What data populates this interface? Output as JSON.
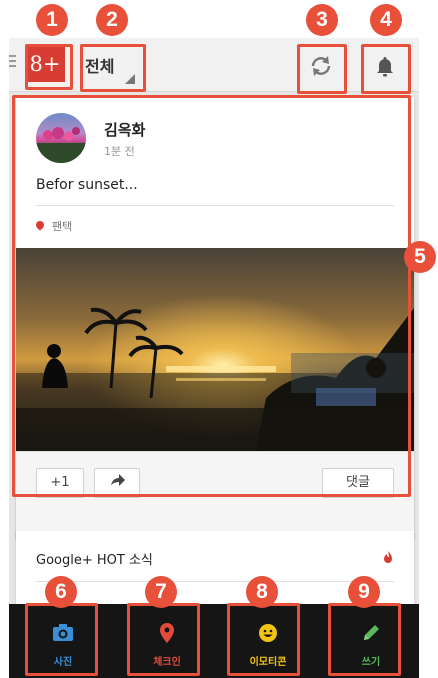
{
  "topbar": {
    "logo_label": "8+",
    "filter_label": "전체"
  },
  "post": {
    "author": "김옥화",
    "time": "1분 전",
    "text": "Befor sunset...",
    "location": "팬택",
    "plus_one_label": "+1",
    "comment_label": "댓글"
  },
  "hot": {
    "title": "Google+ HOT 소식"
  },
  "bottom_tabs": [
    {
      "label": "사진",
      "icon": "camera-icon",
      "color": "#3a8fd6"
    },
    {
      "label": "체크인",
      "icon": "map-pin-icon",
      "color": "#e34a3c"
    },
    {
      "label": "이모티콘",
      "icon": "smiley-icon",
      "color": "#f1c40f"
    },
    {
      "label": "쓰기",
      "icon": "pencil-icon",
      "color": "#5cb85c"
    }
  ],
  "annotations": [
    "1",
    "2",
    "3",
    "4",
    "5",
    "6",
    "7",
    "8",
    "9"
  ],
  "colors": {
    "brand": "#d73d32",
    "annotation": "#e8503a"
  }
}
